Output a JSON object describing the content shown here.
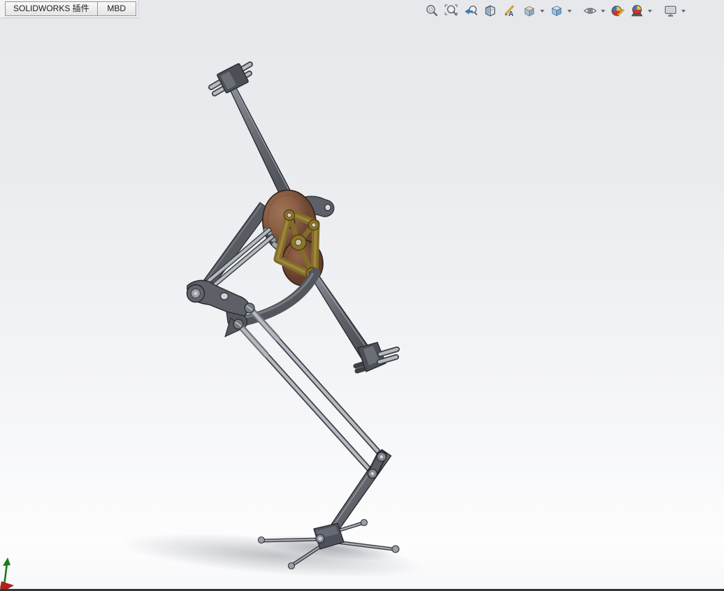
{
  "tabs": [
    {
      "id": "solidworks-addins",
      "label": "SOLIDWORKS 插件"
    },
    {
      "id": "mbd",
      "label": "MBD"
    }
  ],
  "heads_up_toolbar": {
    "items": [
      {
        "icon": "zoom-to-fit",
        "has_dropdown": false
      },
      {
        "icon": "zoom-to-area",
        "has_dropdown": false
      },
      {
        "icon": "previous-view",
        "has_dropdown": false
      },
      {
        "icon": "section-view",
        "has_dropdown": false
      },
      {
        "icon": "dynamic-annotation-views",
        "has_dropdown": false
      },
      {
        "icon": "view-orientation",
        "has_dropdown": true
      },
      {
        "icon": "display-style",
        "has_dropdown": true
      },
      {
        "icon": "hide-show-items",
        "has_dropdown": true
      },
      {
        "icon": "edit-appearance",
        "has_dropdown": false
      },
      {
        "icon": "apply-scene",
        "has_dropdown": true
      },
      {
        "icon": "view-settings",
        "has_dropdown": true
      }
    ]
  },
  "viewport": {
    "model_parts": [
      "top-handle",
      "upper-crank-arm",
      "large-gear",
      "small-gear",
      "ternary-link-plate",
      "right-bracket",
      "hip-link-plate",
      "thigh-rods",
      "shin-rods",
      "knee-joint",
      "lower-leg",
      "lower-handle",
      "foot-base",
      "orientation-triad"
    ],
    "colors": {
      "background_top": "#e6e8ec",
      "background_bottom": "#fdfdfe",
      "gear_brown": "#8a5f45",
      "link_plate_olive": "#8a7430",
      "link_gray": "#5d6067",
      "rod_silver": "#b6bac1",
      "triad_green": "#1c7a1c",
      "triad_red": "#b22016"
    }
  }
}
